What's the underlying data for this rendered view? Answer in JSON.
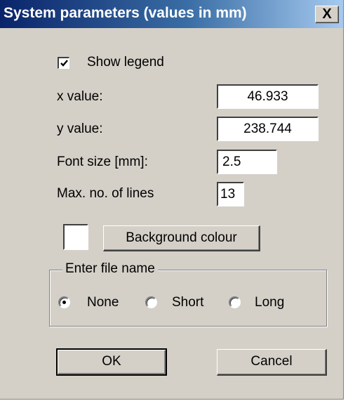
{
  "window": {
    "title": "System parameters (values in mm)",
    "close_glyph": "X"
  },
  "legend": {
    "show_label": "Show legend",
    "checked": true
  },
  "fields": {
    "x_label": "x value:",
    "x_value": "46.933",
    "y_label": "y value:",
    "y_value": "238.744",
    "font_label": "Font size [mm]:",
    "font_value": "2.5",
    "lines_label": "Max. no. of lines",
    "lines_value": "13"
  },
  "background": {
    "button_label": "Background colour",
    "swatch_color": "#ffffff"
  },
  "file_name": {
    "group_label": "Enter file name",
    "options": [
      "None",
      "Short",
      "Long"
    ],
    "selected": "None"
  },
  "buttons": {
    "ok": "OK",
    "cancel": "Cancel"
  }
}
